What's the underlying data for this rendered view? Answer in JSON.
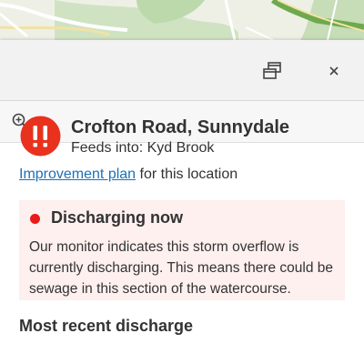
{
  "map": {
    "label": "map-background"
  },
  "panel": {
    "restore_icon": "restore-window-icon",
    "close_icon": "close-icon",
    "zoom_icon": "zoom-in-icon"
  },
  "site": {
    "title": "Crofton Road, Sunnydale",
    "feeds_into": "Feeds into: Kyd Brook",
    "plan_link": "Improvement plan",
    "plan_suffix": " for this location",
    "alert_icon": "exclamation-alert-icon",
    "alert_color": "#e8321e"
  },
  "status": {
    "title": "Discharging now",
    "description": "Our monitor indicates this storm overflow is currently discharging. This means there could be sewage in this section of the watercourse.",
    "dot_color": "#e81a1a",
    "box_color": "#fdf0ef"
  },
  "next_section": {
    "heading": "Most recent discharge"
  }
}
